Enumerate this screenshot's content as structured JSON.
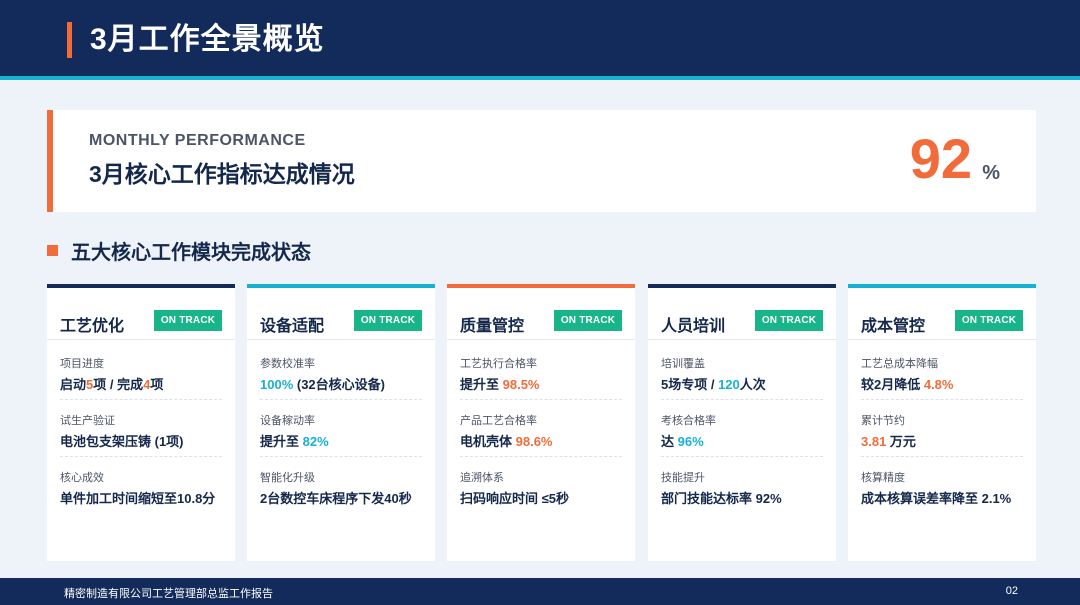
{
  "header": {
    "title": "3月工作全景概览"
  },
  "performance": {
    "kicker": "MONTHLY PERFORMANCE",
    "heading": "3月核心工作指标达成情况",
    "value": "92",
    "unit": "%"
  },
  "section": {
    "title": "五大核心工作模块完成状态"
  },
  "colors": {
    "navy": "#132b5a",
    "orange": "#f26b3a",
    "cyan": "#17b1d6",
    "green": "#19b58a"
  },
  "modules": [
    {
      "name": "工艺优化",
      "badge": "ON TRACK",
      "items": [
        {
          "label": "项目进度",
          "pre": "启动",
          "h1": "5",
          "mid": "项 / 完成",
          "h2": "4",
          "post": "项"
        },
        {
          "label": "试生产验证",
          "pre": "电池包支架压铸 (1项)",
          "h1": "",
          "mid": "",
          "h2": "",
          "post": ""
        },
        {
          "label": "核心成效",
          "pre": "单件加工时间缩短至10.8分",
          "h1": "",
          "mid": "",
          "h2": "",
          "post": ""
        }
      ]
    },
    {
      "name": "设备适配",
      "badge": "ON TRACK",
      "items": [
        {
          "label": "参数校准率",
          "pre": "",
          "h1": "100%",
          "mid": " (32台核心设备)",
          "h2": "",
          "post": ""
        },
        {
          "label": "设备稼动率",
          "pre": "提升至 ",
          "h1": "82%",
          "mid": "",
          "h2": "",
          "post": ""
        },
        {
          "label": "智能化升级",
          "pre": "2台数控车床程序下发40秒",
          "h1": "",
          "mid": "",
          "h2": "",
          "post": ""
        }
      ]
    },
    {
      "name": "质量管控",
      "badge": "ON TRACK",
      "items": [
        {
          "label": "工艺执行合格率",
          "pre": "提升至 ",
          "h1": "98.5%",
          "mid": "",
          "h2": "",
          "post": ""
        },
        {
          "label": "产品工艺合格率",
          "pre": "电机壳体 ",
          "h1": "98.6%",
          "mid": "",
          "h2": "",
          "post": ""
        },
        {
          "label": "追溯体系",
          "pre": "扫码响应时间 ≤5秒",
          "h1": "",
          "mid": "",
          "h2": "",
          "post": ""
        }
      ]
    },
    {
      "name": "人员培训",
      "badge": "ON TRACK",
      "items": [
        {
          "label": "培训覆盖",
          "pre": "5场专项 / ",
          "h1": "120",
          "mid": "人次",
          "h2": "",
          "post": ""
        },
        {
          "label": "考核合格率",
          "pre": "达 ",
          "h1": "96%",
          "mid": "",
          "h2": "",
          "post": ""
        },
        {
          "label": "技能提升",
          "pre": "部门技能达标率 92%",
          "h1": "",
          "mid": "",
          "h2": "",
          "post": ""
        }
      ]
    },
    {
      "name": "成本管控",
      "badge": "ON TRACK",
      "items": [
        {
          "label": "工艺总成本降幅",
          "pre": "较2月降低 ",
          "h1": "4.8%",
          "mid": "",
          "h2": "",
          "post": ""
        },
        {
          "label": "累计节约",
          "pre": "",
          "h1": "3.81",
          "mid": " 万元",
          "h2": "",
          "post": ""
        },
        {
          "label": "核算精度",
          "pre": "成本核算误差率降至 2.1%",
          "h1": "",
          "mid": "",
          "h2": "",
          "post": ""
        }
      ]
    }
  ],
  "footer": {
    "org": "精密制造有限公司工艺管理部总监工作报告",
    "page": "02"
  }
}
